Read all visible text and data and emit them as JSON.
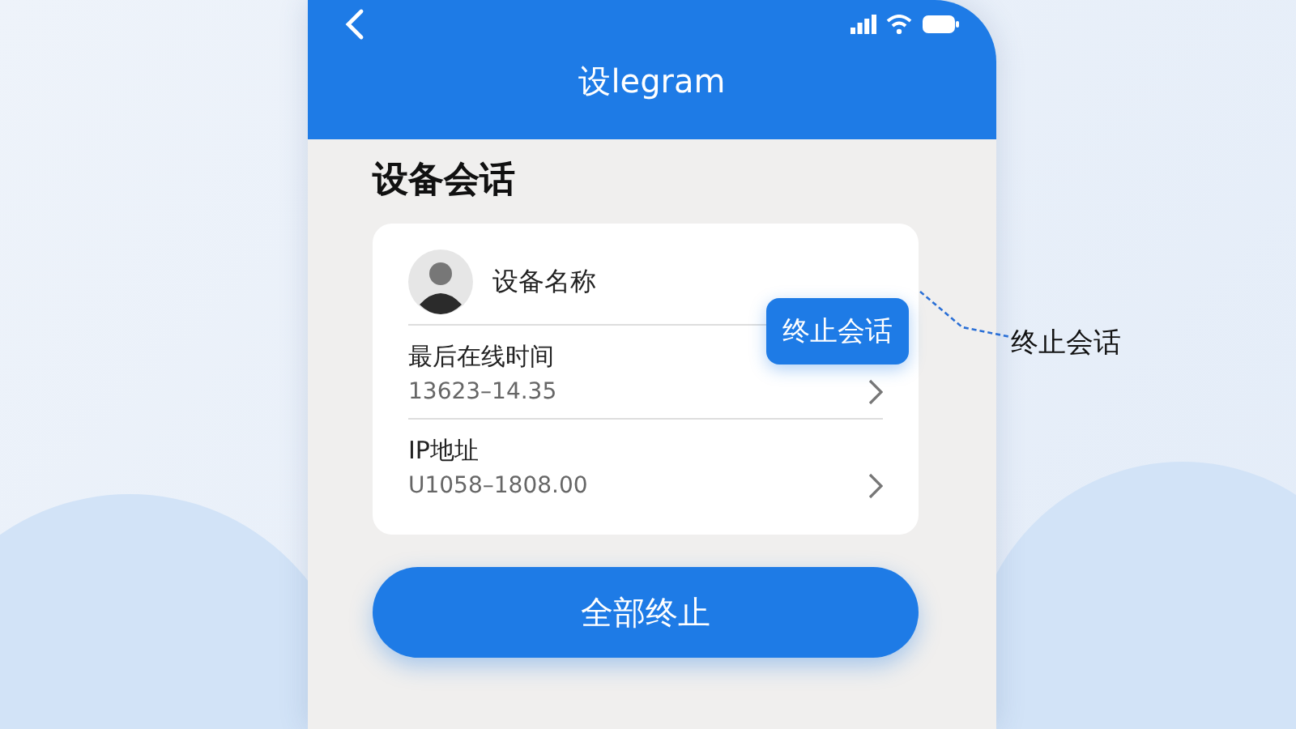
{
  "nav": {
    "title": "设legram"
  },
  "page_title": "设备会话",
  "device": {
    "name": "设备名称",
    "end_button": "终止会话"
  },
  "rows": [
    {
      "label": "最后在线时间",
      "value": "13623–14.35"
    },
    {
      "label": "IP地址",
      "value": "U1058–1808.00"
    }
  ],
  "end_all_button": "全部终止",
  "callout": "终止会话"
}
